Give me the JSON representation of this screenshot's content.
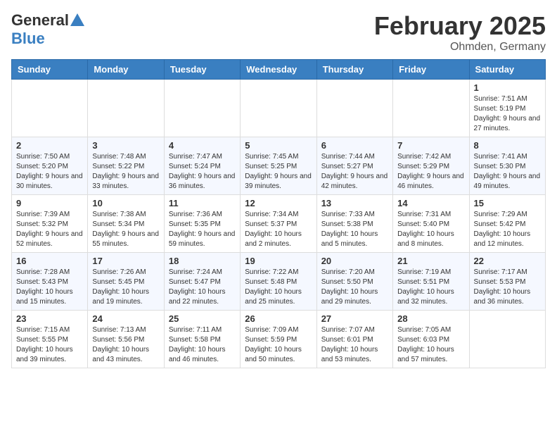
{
  "logo": {
    "general": "General",
    "blue": "Blue"
  },
  "title": {
    "month": "February 2025",
    "location": "Ohmden, Germany"
  },
  "weekdays": [
    "Sunday",
    "Monday",
    "Tuesday",
    "Wednesday",
    "Thursday",
    "Friday",
    "Saturday"
  ],
  "weeks": [
    [
      {
        "day": "",
        "info": ""
      },
      {
        "day": "",
        "info": ""
      },
      {
        "day": "",
        "info": ""
      },
      {
        "day": "",
        "info": ""
      },
      {
        "day": "",
        "info": ""
      },
      {
        "day": "",
        "info": ""
      },
      {
        "day": "1",
        "info": "Sunrise: 7:51 AM\nSunset: 5:19 PM\nDaylight: 9 hours and 27 minutes."
      }
    ],
    [
      {
        "day": "2",
        "info": "Sunrise: 7:50 AM\nSunset: 5:20 PM\nDaylight: 9 hours and 30 minutes."
      },
      {
        "day": "3",
        "info": "Sunrise: 7:48 AM\nSunset: 5:22 PM\nDaylight: 9 hours and 33 minutes."
      },
      {
        "day": "4",
        "info": "Sunrise: 7:47 AM\nSunset: 5:24 PM\nDaylight: 9 hours and 36 minutes."
      },
      {
        "day": "5",
        "info": "Sunrise: 7:45 AM\nSunset: 5:25 PM\nDaylight: 9 hours and 39 minutes."
      },
      {
        "day": "6",
        "info": "Sunrise: 7:44 AM\nSunset: 5:27 PM\nDaylight: 9 hours and 42 minutes."
      },
      {
        "day": "7",
        "info": "Sunrise: 7:42 AM\nSunset: 5:29 PM\nDaylight: 9 hours and 46 minutes."
      },
      {
        "day": "8",
        "info": "Sunrise: 7:41 AM\nSunset: 5:30 PM\nDaylight: 9 hours and 49 minutes."
      }
    ],
    [
      {
        "day": "9",
        "info": "Sunrise: 7:39 AM\nSunset: 5:32 PM\nDaylight: 9 hours and 52 minutes."
      },
      {
        "day": "10",
        "info": "Sunrise: 7:38 AM\nSunset: 5:34 PM\nDaylight: 9 hours and 55 minutes."
      },
      {
        "day": "11",
        "info": "Sunrise: 7:36 AM\nSunset: 5:35 PM\nDaylight: 9 hours and 59 minutes."
      },
      {
        "day": "12",
        "info": "Sunrise: 7:34 AM\nSunset: 5:37 PM\nDaylight: 10 hours and 2 minutes."
      },
      {
        "day": "13",
        "info": "Sunrise: 7:33 AM\nSunset: 5:38 PM\nDaylight: 10 hours and 5 minutes."
      },
      {
        "day": "14",
        "info": "Sunrise: 7:31 AM\nSunset: 5:40 PM\nDaylight: 10 hours and 8 minutes."
      },
      {
        "day": "15",
        "info": "Sunrise: 7:29 AM\nSunset: 5:42 PM\nDaylight: 10 hours and 12 minutes."
      }
    ],
    [
      {
        "day": "16",
        "info": "Sunrise: 7:28 AM\nSunset: 5:43 PM\nDaylight: 10 hours and 15 minutes."
      },
      {
        "day": "17",
        "info": "Sunrise: 7:26 AM\nSunset: 5:45 PM\nDaylight: 10 hours and 19 minutes."
      },
      {
        "day": "18",
        "info": "Sunrise: 7:24 AM\nSunset: 5:47 PM\nDaylight: 10 hours and 22 minutes."
      },
      {
        "day": "19",
        "info": "Sunrise: 7:22 AM\nSunset: 5:48 PM\nDaylight: 10 hours and 25 minutes."
      },
      {
        "day": "20",
        "info": "Sunrise: 7:20 AM\nSunset: 5:50 PM\nDaylight: 10 hours and 29 minutes."
      },
      {
        "day": "21",
        "info": "Sunrise: 7:19 AM\nSunset: 5:51 PM\nDaylight: 10 hours and 32 minutes."
      },
      {
        "day": "22",
        "info": "Sunrise: 7:17 AM\nSunset: 5:53 PM\nDaylight: 10 hours and 36 minutes."
      }
    ],
    [
      {
        "day": "23",
        "info": "Sunrise: 7:15 AM\nSunset: 5:55 PM\nDaylight: 10 hours and 39 minutes."
      },
      {
        "day": "24",
        "info": "Sunrise: 7:13 AM\nSunset: 5:56 PM\nDaylight: 10 hours and 43 minutes."
      },
      {
        "day": "25",
        "info": "Sunrise: 7:11 AM\nSunset: 5:58 PM\nDaylight: 10 hours and 46 minutes."
      },
      {
        "day": "26",
        "info": "Sunrise: 7:09 AM\nSunset: 5:59 PM\nDaylight: 10 hours and 50 minutes."
      },
      {
        "day": "27",
        "info": "Sunrise: 7:07 AM\nSunset: 6:01 PM\nDaylight: 10 hours and 53 minutes."
      },
      {
        "day": "28",
        "info": "Sunrise: 7:05 AM\nSunset: 6:03 PM\nDaylight: 10 hours and 57 minutes."
      },
      {
        "day": "",
        "info": ""
      }
    ]
  ]
}
